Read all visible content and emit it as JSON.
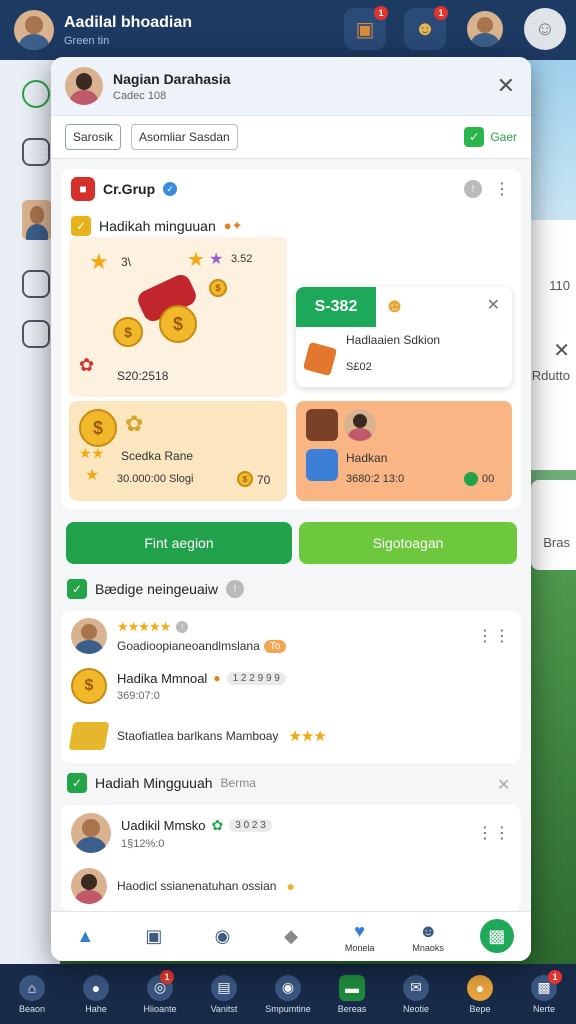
{
  "app": {
    "user_name": "Aadilal bhoadian",
    "user_status": "Green tin"
  },
  "bg_right": {
    "value_a": "110",
    "value_b": "Rdutto",
    "value_c": "Bras"
  },
  "bottom_nav": [
    {
      "label": "Beaon",
      "icon": "home-icon"
    },
    {
      "label": "Hahe",
      "icon": "bag-icon"
    },
    {
      "label": "Hiioante",
      "icon": "target-icon"
    },
    {
      "label": "Vanitst",
      "icon": "gift-icon"
    },
    {
      "label": "Smpumtine",
      "icon": "chat-icon"
    },
    {
      "label": "Bereas",
      "icon": "ticket-icon"
    },
    {
      "label": "Neotie",
      "icon": "mail-icon"
    },
    {
      "label": "Bepe",
      "icon": "pet-icon"
    },
    {
      "label": "Nerte",
      "icon": "box-icon"
    }
  ],
  "modal": {
    "user_name": "Nagian Darahasia",
    "user_sub": "Cadec 108",
    "chip_1": "Sarosik",
    "chip_2": "Asomliar Sasdan",
    "green_link": "Gaer",
    "group_title": "Cr.Grup",
    "weekly_title": "Hadikah minguuan",
    "reward_big_value": "S20:2518",
    "reward_big_topright": "3.52",
    "reward_big_mid": "3\\",
    "reward_gold_title": "Scedka Rane",
    "reward_gold_value": "30.000:00 Slogi",
    "reward_gold_coin": "70",
    "reward_white_tag": "S-382",
    "reward_white_title": "Hadlaaien Sdkion",
    "reward_white_sub": "S£02",
    "reward_orange_title": "Hadkan",
    "reward_orange_value": "3680:2 13:0",
    "reward_orange_coin": "00",
    "btn_left": "Fint aegion",
    "btn_right": "Sigotoagan",
    "section2_title": "Bædige neingeuaiw",
    "s2_row1_text": "Goadioopianeoandlmslana",
    "s2_row1_tag": "To",
    "s2_row2_title": "Hadika Mmnoal",
    "s2_row2_pill": "1 2 2 9 9 9",
    "s2_row2_num": "369:07:0",
    "s2_row3_text": "Staofiatlea barlkans Mamboay",
    "section3_title": "Hadiah Mingguuah",
    "section3_sub": "Berma",
    "s3_row1_title": "Uadikil Mmsko",
    "s3_row1_pill": "3 0 2 3",
    "s3_row1_sub": "1§12%:0",
    "s3_row2_text": "Haodicl ssianenatuhan ossian",
    "tabs": [
      {
        "label": "",
        "icon": "thumbs-up-icon"
      },
      {
        "label": "",
        "icon": "display-icon"
      },
      {
        "label": "",
        "icon": "chat-bubble-icon"
      },
      {
        "label": "",
        "icon": "gamepad-icon"
      },
      {
        "label": "Monela",
        "icon": "heart-globe-icon"
      },
      {
        "label": "Mnaoks",
        "icon": "people-icon"
      },
      {
        "label": "",
        "icon": "screen-icon"
      }
    ]
  },
  "colors": {
    "primary_green": "#21a24a",
    "light_green": "#6dc83d",
    "navy": "#1d3a63",
    "orange": "#f9b584"
  }
}
